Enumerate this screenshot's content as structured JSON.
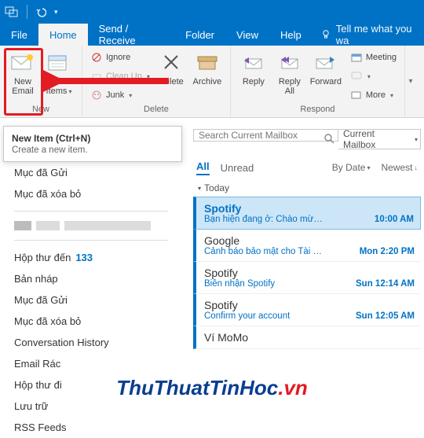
{
  "titlebar": {},
  "tabs": {
    "file": "File",
    "home": "Home",
    "sendreceive": "Send / Receive",
    "folder": "Folder",
    "view": "View",
    "help": "Help",
    "tellme": "Tell me what you wa"
  },
  "ribbon": {
    "groups": {
      "new": "New",
      "delete": "Delete",
      "respond": "Respond"
    },
    "new_email_l1": "New",
    "new_email_l2": "Email",
    "new_items_l1": "New",
    "new_items_l2": "Items",
    "ignore": "Ignore",
    "cleanup": "Clean Up",
    "junk": "Junk",
    "delete": "Delete",
    "archive": "Archive",
    "reply": "Reply",
    "replyall_l1": "Reply",
    "replyall_l2": "All",
    "forward": "Forward",
    "meeting": "Meeting",
    "more": "More"
  },
  "tooltip": {
    "title": "New Item (Ctrl+N)",
    "desc": "Create a new item."
  },
  "nav": {
    "sent1": "Mục đã Gửi",
    "deleted1": "Mục đã xóa bỏ",
    "inbox": "Hộp thư đến",
    "inbox_count": "133",
    "drafts": "Bản nháp",
    "sent2": "Mục đã Gửi",
    "deleted2": "Mục đã xóa bỏ",
    "conv": "Conversation History",
    "junk": "Email Rác",
    "outbox": "Hộp thư đi",
    "archive": "Lưu trữ",
    "rss": "RSS Feeds"
  },
  "search": {
    "placeholder": "Search Current Mailbox",
    "scope": "Current Mailbox"
  },
  "filters": {
    "all": "All",
    "unread": "Unread",
    "bydate": "By Date",
    "newest": "Newest"
  },
  "group_today": "Today",
  "messages": [
    {
      "from": "Spotify",
      "subject": "Bạn hiện đang ở: Chào mừ…",
      "time": "10:00 AM"
    },
    {
      "from": "Google",
      "subject": "Cảnh báo bảo mật cho Tài …",
      "time": "Mon 2:20 PM"
    },
    {
      "from": "Spotify",
      "subject": "Biên nhận Spotify",
      "time": "Sun 12:14 AM"
    },
    {
      "from": "Spotify",
      "subject": "Confirm your account",
      "time": "Sun 12:05 AM"
    },
    {
      "from": "Ví MoMo",
      "subject": "",
      "time": ""
    }
  ],
  "watermark": {
    "a": "ThuThuatTinHoc",
    "b": ".vn"
  }
}
